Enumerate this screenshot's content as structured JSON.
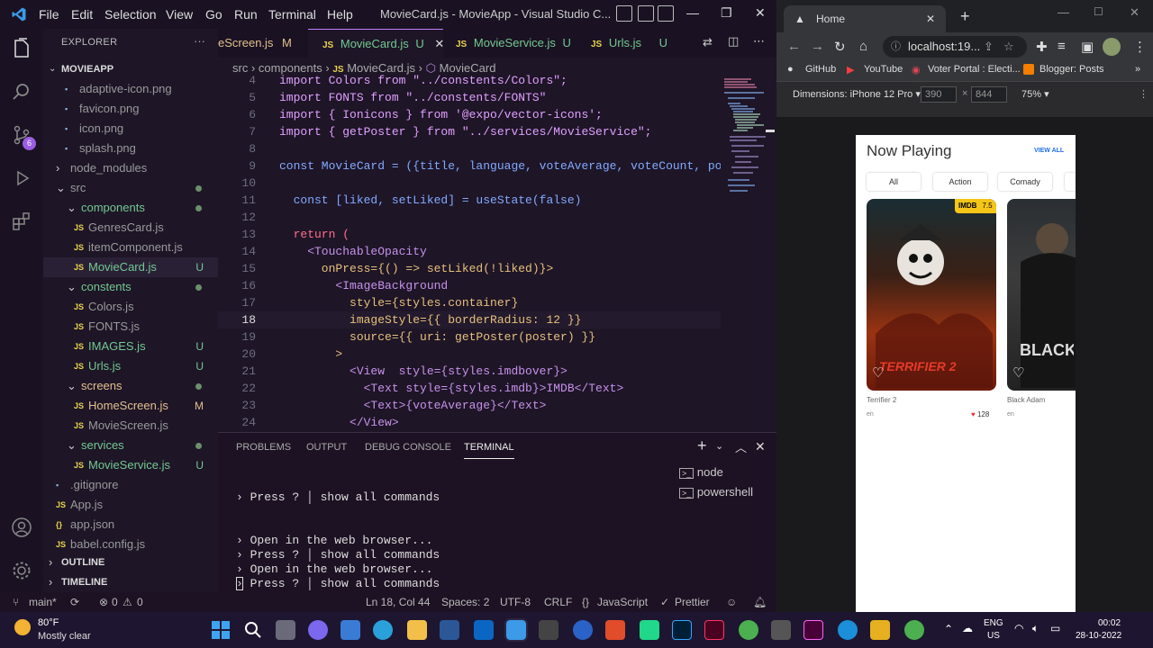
{
  "vscode": {
    "menu": [
      "File",
      "Edit",
      "Selection",
      "View",
      "Go",
      "Run",
      "Terminal",
      "Help"
    ],
    "window_title": "MovieCard.js - MovieApp - Visual Studio C...",
    "scm_badge": "6",
    "explorer_header": "EXPLORER",
    "explorer_more": "···",
    "project": "MOVIEAPP",
    "tree": [
      {
        "label": "adaptive-icon.png",
        "status": "",
        "color": "grey"
      },
      {
        "label": "favicon.png",
        "status": "",
        "color": "grey"
      },
      {
        "label": "icon.png",
        "status": "",
        "color": "grey"
      },
      {
        "label": "splash.png",
        "status": "",
        "color": "grey"
      },
      {
        "label": "node_modules",
        "status": "",
        "color": "grey"
      },
      {
        "label": "src",
        "status": "dot",
        "color": "grey"
      },
      {
        "label": "components",
        "status": "dot",
        "color": "green"
      },
      {
        "label": "GenresCard.js",
        "status": "",
        "color": "grey"
      },
      {
        "label": "itemComponent.js",
        "status": "",
        "color": "grey"
      },
      {
        "label": "MovieCard.js",
        "status": "U",
        "color": "green"
      },
      {
        "label": "constents",
        "status": "dot",
        "color": "green"
      },
      {
        "label": "Colors.js",
        "status": "",
        "color": "grey"
      },
      {
        "label": "FONTS.js",
        "status": "",
        "color": "grey"
      },
      {
        "label": "IMAGES.js",
        "status": "U",
        "color": "green"
      },
      {
        "label": "Urls.js",
        "status": "U",
        "color": "green"
      },
      {
        "label": "screens",
        "status": "dot",
        "color": "yellow"
      },
      {
        "label": "HomeScreen.js",
        "status": "M",
        "color": "yellow"
      },
      {
        "label": "MovieScreen.js",
        "status": "",
        "color": "grey"
      },
      {
        "label": "services",
        "status": "dot",
        "color": "green"
      },
      {
        "label": "MovieService.js",
        "status": "U",
        "color": "green"
      },
      {
        "label": ".gitignore",
        "status": "",
        "color": "grey"
      },
      {
        "label": "App.js",
        "status": "",
        "color": "grey"
      },
      {
        "label": "app.json",
        "status": "",
        "color": "grey"
      },
      {
        "label": "babel.config.js",
        "status": "",
        "color": "grey"
      }
    ],
    "outline": "OUTLINE",
    "timeline": "TIMELINE",
    "tabs": [
      {
        "name": "eScreen.js",
        "status": "M"
      },
      {
        "name": "MovieCard.js",
        "status": "U"
      },
      {
        "name": "MovieService.js",
        "status": "U"
      },
      {
        "name": "Urls.js",
        "status": "U"
      }
    ],
    "breadcrumb": [
      "src",
      "components",
      "MovieCard.js",
      "MovieCard"
    ],
    "code_lines": [
      {
        "n": "4",
        "t": "import Colors from \"../constents/Colors\";"
      },
      {
        "n": "5",
        "t": "import FONTS from \"../constents/FONTS\""
      },
      {
        "n": "6",
        "t": "import { Ionicons } from '@expo/vector-icons';"
      },
      {
        "n": "7",
        "t": "import { getPoster } from \"../services/MovieService\";"
      },
      {
        "n": "8",
        "t": ""
      },
      {
        "n": "9",
        "t": "const MovieCard = ({title, language, voteAverage, voteCount, pos"
      },
      {
        "n": "10",
        "t": ""
      },
      {
        "n": "11",
        "t": "  const [liked, setLiked] = useState(false)"
      },
      {
        "n": "12",
        "t": ""
      },
      {
        "n": "13",
        "t": "  return ("
      },
      {
        "n": "14",
        "t": "    <TouchableOpacity"
      },
      {
        "n": "15",
        "t": "      onPress={() => setLiked(!liked)}>"
      },
      {
        "n": "16",
        "t": "        <ImageBackground"
      },
      {
        "n": "17",
        "t": "          style={styles.container}"
      },
      {
        "n": "18",
        "t": "          imageStyle={{ borderRadius: 12 }}"
      },
      {
        "n": "19",
        "t": "          source={{ uri: getPoster(poster) }}"
      },
      {
        "n": "20",
        "t": "        >"
      },
      {
        "n": "21",
        "t": "          <View  style={styles.imdbover}>"
      },
      {
        "n": "22",
        "t": "            <Text style={styles.imdb}>IMDB</Text>"
      },
      {
        "n": "23",
        "t": "            <Text>{voteAverage}</Text>"
      },
      {
        "n": "24",
        "t": "          </View>"
      }
    ],
    "panel_tabs": [
      "PROBLEMS",
      "OUTPUT",
      "DEBUG CONSOLE",
      "TERMINAL"
    ],
    "terminal_lines": [
      "› Press ? │ show all commands",
      "",
      "› Open in the web browser...",
      "› Press ? │ show all commands",
      "› Open in the web browser...",
      "› Press ? │ show all commands"
    ],
    "terminals": [
      "node",
      "powershell"
    ],
    "status": {
      "branch": "main*",
      "errors": "0",
      "warnings": "0",
      "position": "Ln 18, Col 44",
      "spaces": "Spaces: 2",
      "encoding": "UTF-8",
      "eol": "CRLF",
      "language": "JavaScript",
      "prettier": "Prettier"
    }
  },
  "chrome": {
    "tab_title": "Home",
    "url": "localhost:19...",
    "bookmarks": [
      "GitHub",
      "YouTube",
      "Voter Portal : Electi...",
      "Blogger: Posts"
    ],
    "device": "Dimensions: iPhone 12 Pro",
    "width": "390",
    "height": "844",
    "zoom": "75%",
    "app": {
      "title": "Now Playing",
      "view_all": "VIEW ALL",
      "genres": [
        "All",
        "Action",
        "Comady"
      ],
      "movies": [
        {
          "title": "Terrifier 2",
          "lang": "en",
          "imdb": "IMDB",
          "rating": "7.5",
          "likes": "128",
          "poster_text": "TERRIFIER 2"
        },
        {
          "title": "Black Adam",
          "lang": "en",
          "poster_text": "BLACK ADAM"
        }
      ]
    }
  },
  "taskbar": {
    "temp": "80°F",
    "weather": "Mostly clear",
    "lang1": "ENG",
    "lang2": "US",
    "time": "00:02",
    "date": "28-10-2022"
  },
  "colors": {
    "vscode_bg": "#1e1527",
    "accent": "#73c991",
    "modified": "#e2c08d",
    "imdb": "#f5c518",
    "link": "#1e6fe8"
  }
}
